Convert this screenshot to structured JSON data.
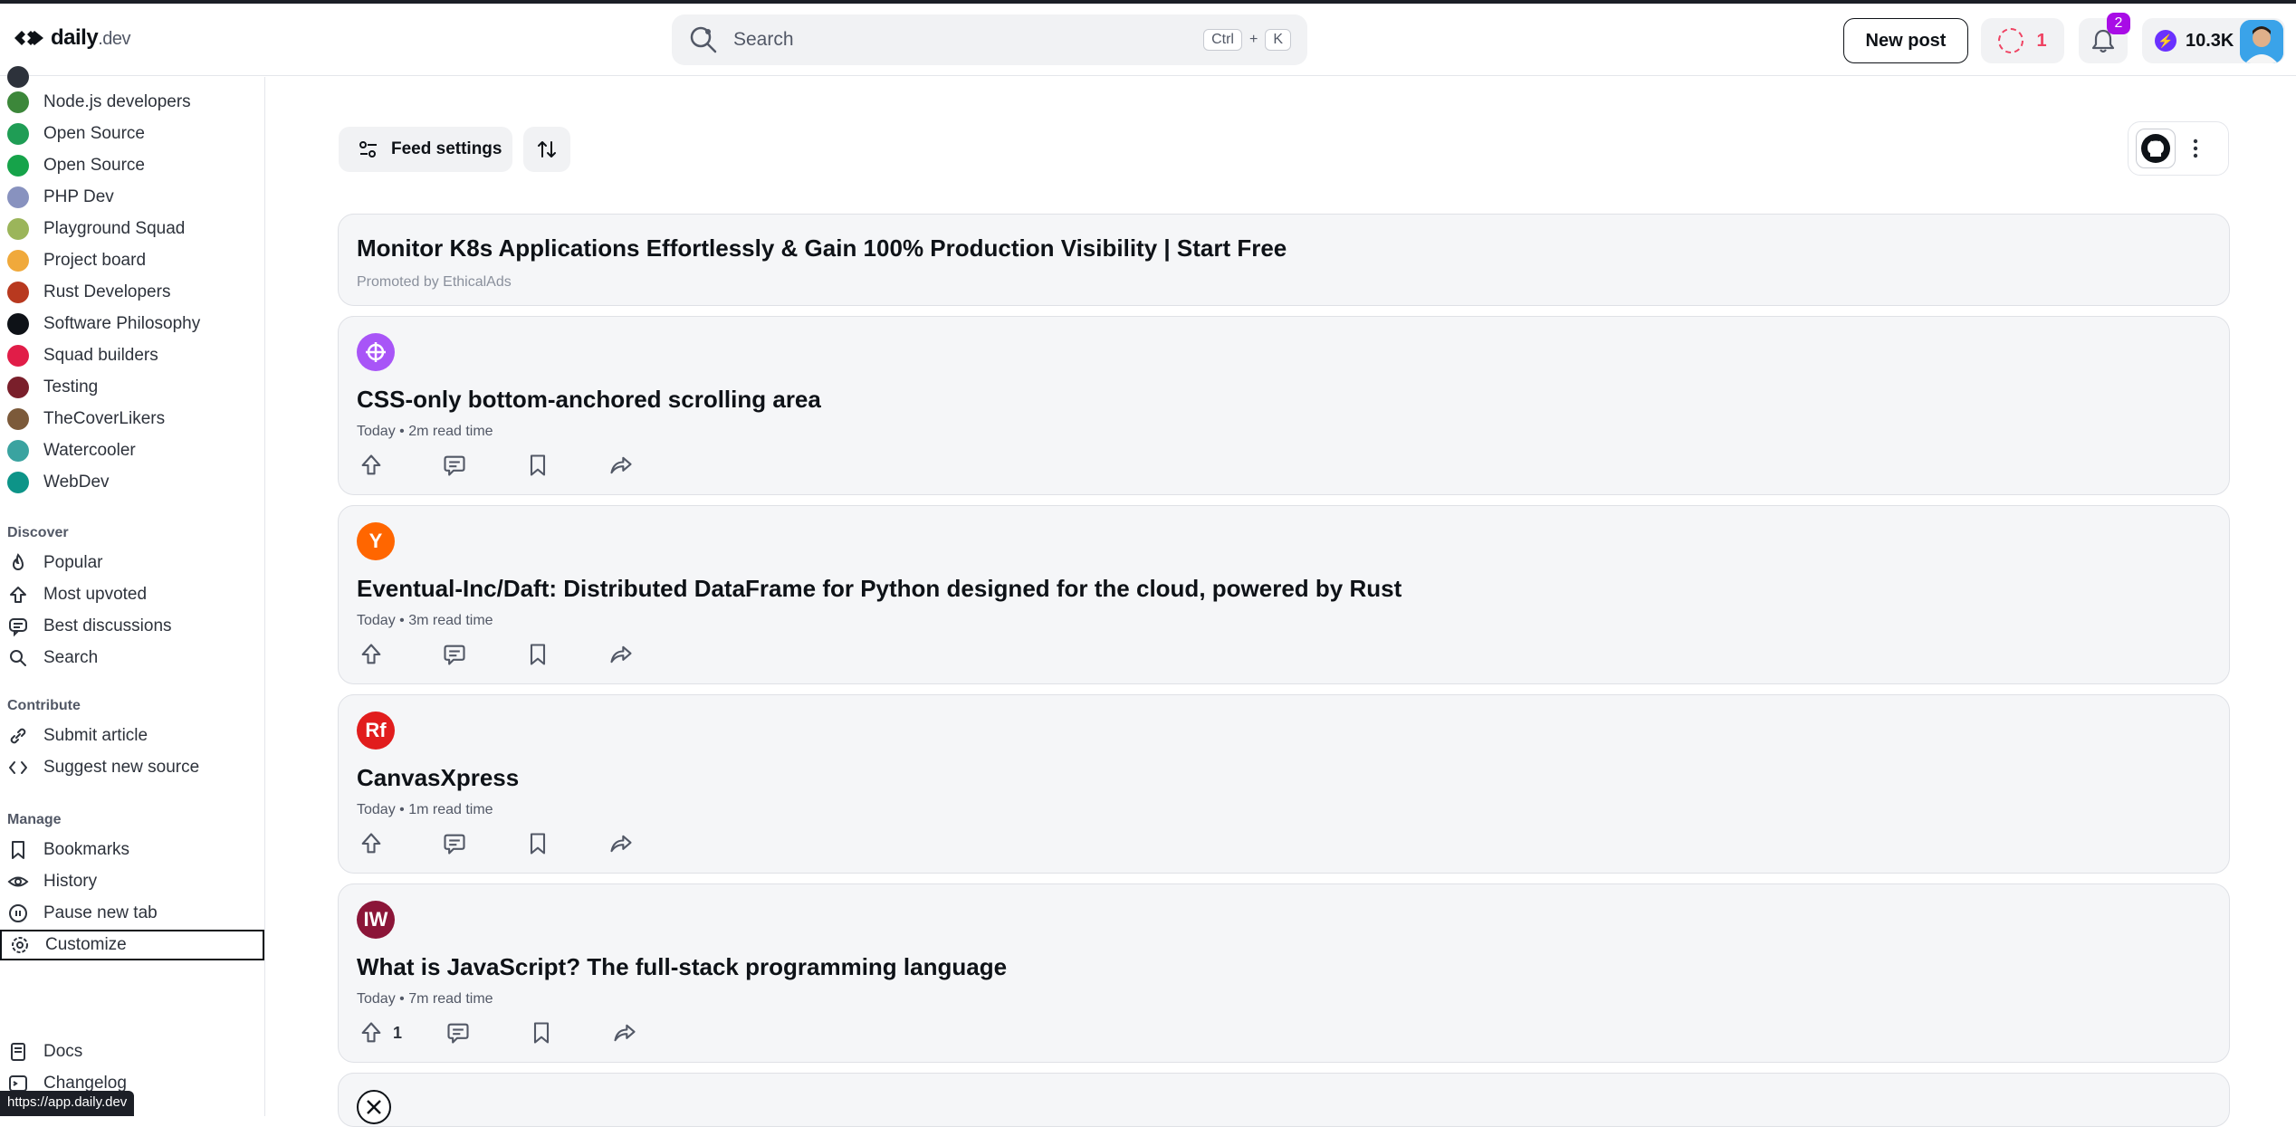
{
  "header": {
    "logo_text": "daily",
    "logo_suffix": ".dev",
    "search_placeholder": "Search",
    "kbd_ctrl": "Ctrl",
    "kbd_plus": "+",
    "kbd_k": "K",
    "new_post_label": "New post",
    "streak_count": "1",
    "notification_count": "2",
    "reputation": "10.3K"
  },
  "sidebar": {
    "squads": [
      {
        "label": "Node.js developers",
        "color": "#3c873a"
      },
      {
        "label": "Open Source",
        "color": "#1f9d55"
      },
      {
        "label": "Open Source",
        "color": "#16a34a"
      },
      {
        "label": "PHP Dev",
        "color": "#8892bf"
      },
      {
        "label": "Playground Squad",
        "color": "#9bb55a"
      },
      {
        "label": "Project board",
        "color": "#f0a93b"
      },
      {
        "label": "Rust Developers",
        "color": "#b8391f"
      },
      {
        "label": "Software Philosophy",
        "color": "#0e1217"
      },
      {
        "label": "Squad builders",
        "color": "#e11d48"
      },
      {
        "label": "Testing",
        "color": "#7a1f2b"
      },
      {
        "label": "TheCoverLikers",
        "color": "#7c5a3a"
      },
      {
        "label": "Watercooler",
        "color": "#3aa3a0"
      },
      {
        "label": "WebDev",
        "color": "#0d9488"
      }
    ],
    "discover_heading": "Discover",
    "discover": [
      {
        "label": "Popular",
        "icon": "flame-icon"
      },
      {
        "label": "Most upvoted",
        "icon": "upvote-icon"
      },
      {
        "label": "Best discussions",
        "icon": "discussion-icon"
      },
      {
        "label": "Search",
        "icon": "search-icon"
      }
    ],
    "contribute_heading": "Contribute",
    "contribute": [
      {
        "label": "Submit article",
        "icon": "link-icon"
      },
      {
        "label": "Suggest new source",
        "icon": "code-icon"
      }
    ],
    "manage_heading": "Manage",
    "manage": [
      {
        "label": "Bookmarks",
        "icon": "bookmark-icon"
      },
      {
        "label": "History",
        "icon": "eye-icon"
      },
      {
        "label": "Pause new tab",
        "icon": "pause-icon"
      },
      {
        "label": "Customize",
        "icon": "gear-icon"
      }
    ],
    "footer": [
      {
        "label": "Docs",
        "icon": "docs-icon"
      },
      {
        "label": "Changelog",
        "icon": "terminal-icon"
      }
    ],
    "status_url": "https://app.daily.dev"
  },
  "feed": {
    "feed_settings_label": "Feed settings",
    "ad": {
      "title": "Monitor K8s Applications Effortlessly & Gain 100% Production Visibility | Start Free",
      "promoted": "Promoted by EthicalAds"
    },
    "posts": [
      {
        "title": "CSS-only bottom-anchored scrolling area",
        "meta": "Today • 2m read time",
        "source_letter": "",
        "source_color": "#a855f7",
        "upvotes": ""
      },
      {
        "title": "Eventual-Inc/Daft: Distributed DataFrame for Python designed for the cloud, powered by Rust",
        "meta": "Today • 3m read time",
        "source_letter": "Y",
        "source_color": "#ff6600",
        "upvotes": ""
      },
      {
        "title": "CanvasXpress",
        "meta": "Today • 1m read time",
        "source_letter": "Rf",
        "source_color": "#e11d1d",
        "upvotes": ""
      },
      {
        "title": "What is JavaScript? The full-stack programming language",
        "meta": "Today • 7m read time",
        "source_letter": "IW",
        "source_color": "#8b1538",
        "upvotes": "1"
      }
    ]
  }
}
